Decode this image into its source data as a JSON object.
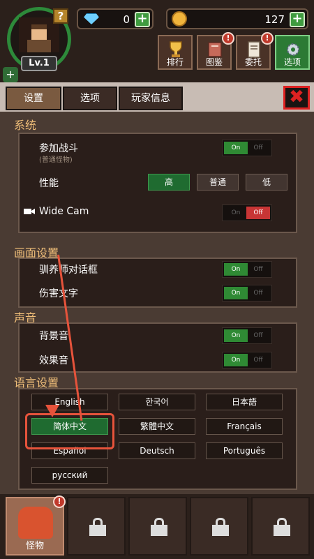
{
  "header": {
    "level": "Lv.1",
    "help": "?",
    "gems": "0",
    "gold": "127",
    "add": "+",
    "buttons": [
      {
        "label": "排行",
        "icon": "trophy-icon",
        "alert": ""
      },
      {
        "label": "图鉴",
        "icon": "book-icon",
        "alert": "!"
      },
      {
        "label": "委托",
        "icon": "scroll-icon",
        "alert": "!"
      },
      {
        "label": "选项",
        "icon": "gear-icon",
        "alert": ""
      }
    ]
  },
  "tabs": [
    {
      "label": "设置",
      "active": true
    },
    {
      "label": "选项",
      "active": false
    },
    {
      "label": "玩家信息",
      "active": false
    }
  ],
  "close": "✖",
  "system": {
    "title": "系统",
    "battle_label": "参加战斗",
    "battle_sub": "(普通怪物)",
    "battle_on": "On",
    "battle_off": "Off",
    "perf_label": "性能",
    "perf_options": [
      "高",
      "普通",
      "低"
    ],
    "perf_selected": "高",
    "widecam_label": "Wide Cam",
    "widecam_on": "On",
    "widecam_off": "Off"
  },
  "display": {
    "title": "画面设置",
    "dialog_label": "驯养师对话框",
    "damage_label": "伤害文字",
    "on": "On",
    "off": "Off"
  },
  "sound": {
    "title": "声音",
    "bgm_label": "背景音",
    "sfx_label": "效果音",
    "on": "On",
    "off": "Off"
  },
  "language": {
    "title": "语言设置",
    "options": [
      "English",
      "한국어",
      "日本語",
      "简体中文",
      "繁體中文",
      "Français",
      "Español",
      "Deutsch",
      "Português",
      "русский"
    ],
    "selected": "简体中文"
  },
  "bottom": {
    "active_label": "怪物",
    "alert": "!"
  },
  "colors": {
    "section_title": "#f2c07a",
    "toggle_on": "#2f8a34",
    "toggle_off": "#c83535",
    "annotation": "#e6533b"
  }
}
